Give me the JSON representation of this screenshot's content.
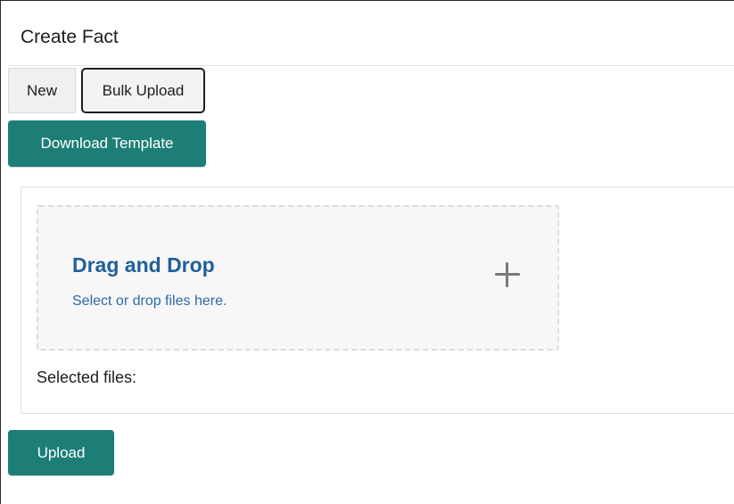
{
  "form": {
    "title": "Create Fact"
  },
  "tabs": {
    "new_label": "New",
    "bulk_upload_label": "Bulk Upload",
    "active": "Bulk Upload"
  },
  "actions": {
    "download_template_label": "Download Template",
    "upload_label": "Upload"
  },
  "dropzone": {
    "title": "Drag and Drop",
    "hint": "Select or drop files here.",
    "icon": "plus-icon"
  },
  "selected_files": {
    "label": "Selected files:"
  },
  "colors": {
    "accent": "#1d7e78",
    "link": "#1f5f9a",
    "dropzone_bg": "#f7f7f7"
  }
}
